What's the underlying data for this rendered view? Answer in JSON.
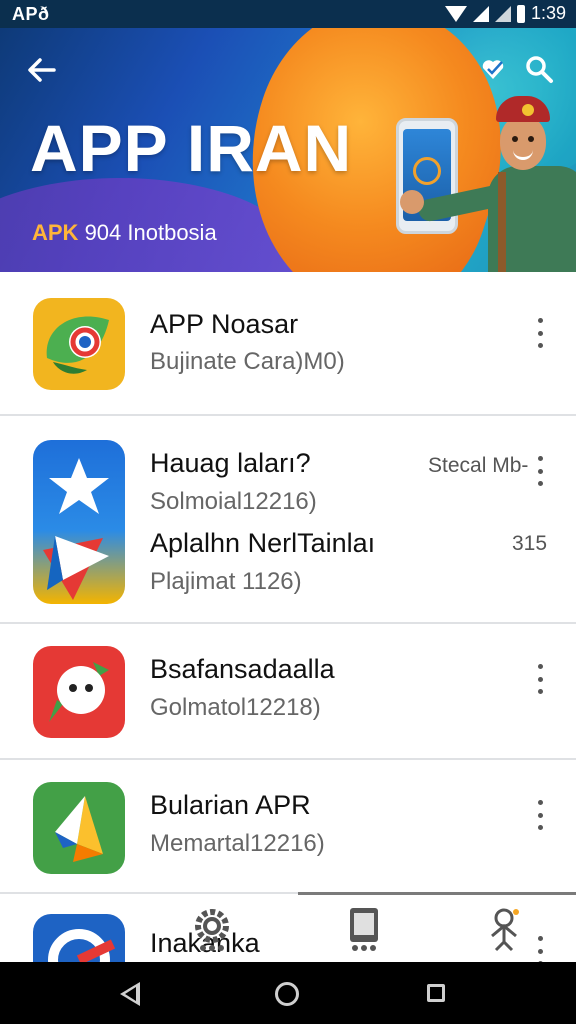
{
  "status_bar": {
    "left_label": "APð",
    "time": "1:39"
  },
  "banner": {
    "title": "APP IRAN",
    "subtitle_brand": "APK",
    "subtitle_rest": " 904 Inotbosia"
  },
  "apps": [
    {
      "title": "APP Noasar",
      "subtitle": "Bujinate Cara)M0)"
    },
    {
      "title": "Hauag laları?",
      "subtitle": "Solmoial12216)",
      "meta": "Stecal Mb-",
      "title2": "Aplalhn NerlTainlaı",
      "subtitle2": "Plajimat 1126)",
      "meta2": "315"
    },
    {
      "title": "Bsafansadaalla",
      "subtitle": "Golmatol12218)"
    },
    {
      "title": "Bularian APR",
      "subtitle": "Memartal12216)"
    },
    {
      "title": "Inakanka",
      "subtitle": ""
    }
  ],
  "colors": {
    "status_bar": "#0b2f4e",
    "banner_accent": "#f58a1f",
    "brand_orange": "#ffb53a"
  }
}
